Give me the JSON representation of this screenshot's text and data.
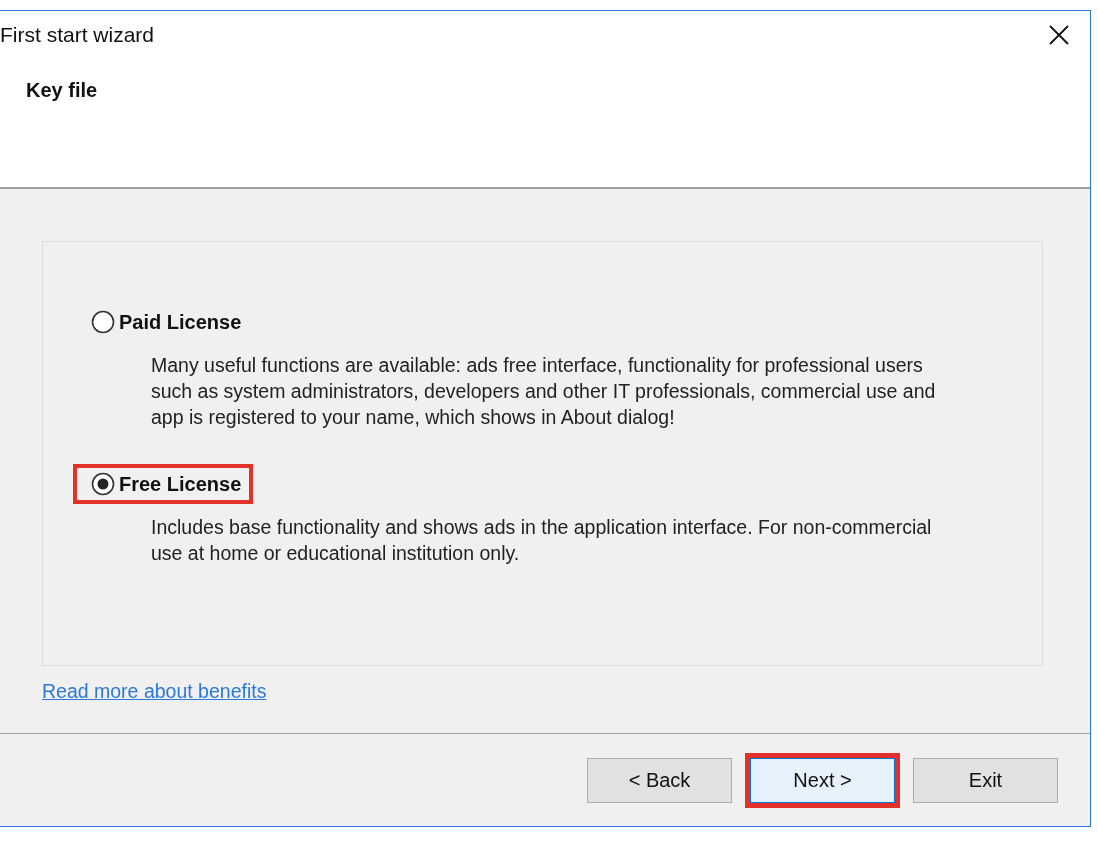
{
  "window": {
    "title": "First start wizard"
  },
  "header": {
    "title": "Key file"
  },
  "options": [
    {
      "label": "Paid License",
      "selected": false,
      "highlighted": false,
      "description": "Many useful functions are available: ads free interface, functionality for professional users such as system administrators, developers and other IT professionals, commercial use and app is registered to your name, which shows in About dialog!"
    },
    {
      "label": "Free License",
      "selected": true,
      "highlighted": true,
      "description": "Includes base functionality and shows ads in the application interface. For non-commercial use at home or educational institution only."
    }
  ],
  "link": "Read more about benefits",
  "buttons": [
    {
      "label": "< Back",
      "focused": false,
      "highlighted": false
    },
    {
      "label": "Next >",
      "focused": true,
      "highlighted": true
    },
    {
      "label": "Exit",
      "focused": false,
      "highlighted": false
    }
  ]
}
